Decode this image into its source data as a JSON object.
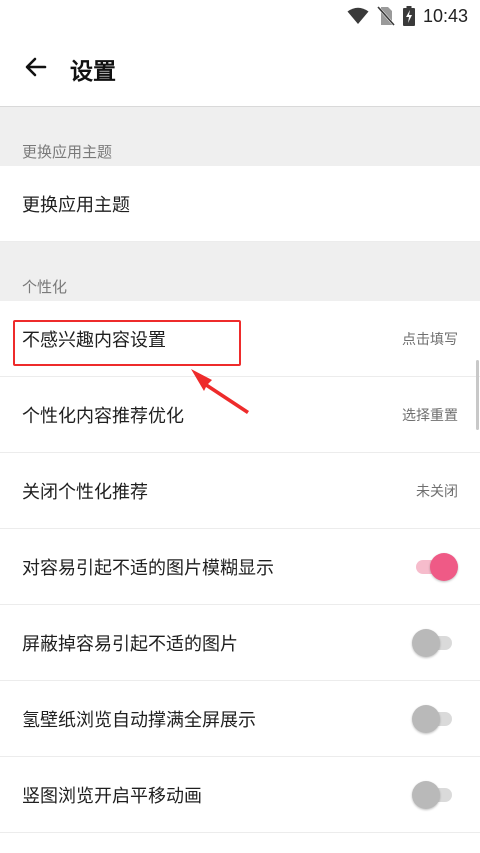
{
  "status_bar": {
    "time": "10:43",
    "icons": [
      "wifi-icon",
      "no-sim-icon",
      "battery-charging-icon"
    ]
  },
  "app_bar": {
    "back_icon": "arrow-left-icon",
    "title": "设置"
  },
  "sections": [
    {
      "header": "更换应用主题",
      "rows": [
        {
          "label": "更换应用主题"
        }
      ]
    },
    {
      "header": "个性化",
      "rows": [
        {
          "label": "不感兴趣内容设置",
          "value": "点击填写"
        },
        {
          "label": "个性化内容推荐优化",
          "value": "选择重置"
        },
        {
          "label": "关闭个性化推荐",
          "value": "未关闭"
        },
        {
          "label": "对容易引起不适的图片模糊显示",
          "toggle": true
        },
        {
          "label": "屏蔽掉容易引起不适的图片",
          "toggle": false
        },
        {
          "label": "氢壁纸浏览自动撑满全屏展示",
          "toggle": false
        },
        {
          "label": "竖图浏览开启平移动画",
          "toggle": false
        }
      ]
    }
  ],
  "colors": {
    "accent": "#ef5a86",
    "annotation": "#ee2b2b",
    "section_background": "#efefef"
  }
}
